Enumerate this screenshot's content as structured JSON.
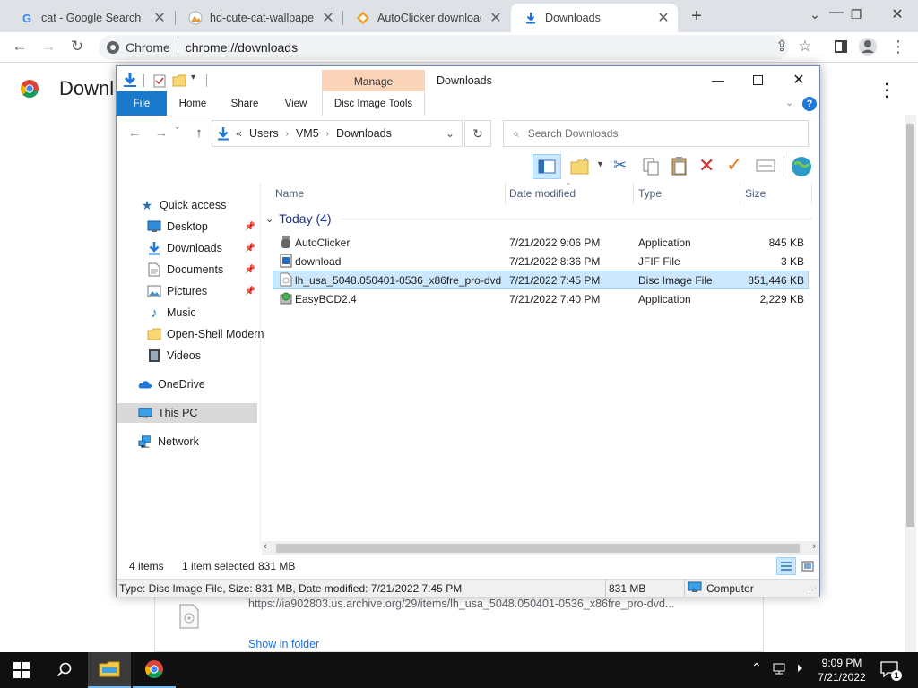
{
  "browser": {
    "tabs": [
      {
        "title": "cat - Google Search",
        "favicon": "google-g-icon"
      },
      {
        "title": "hd-cute-cat-wallpaper",
        "favicon": "image-icon"
      },
      {
        "title": "AutoClicker download",
        "favicon": "softonic-icon"
      },
      {
        "title": "Downloads",
        "favicon": "download-icon"
      }
    ],
    "new_tab": "+",
    "omnibox_label": "Chrome",
    "omnibox_url": "chrome://downloads",
    "page_title": "Downl"
  },
  "download_item": {
    "url": "https://ia902803.us.archive.org/29/items/lh_usa_5048.050401-0536_x86fre_pro-dvd...",
    "show_in_folder": "Show in folder"
  },
  "explorer": {
    "title": "Downloads",
    "manage": "Manage",
    "ribbon_tabs": [
      "File",
      "Home",
      "Share",
      "View",
      "Disc Image Tools"
    ],
    "breadcrumb": [
      "Users",
      "VM5",
      "Downloads"
    ],
    "breadcrumb_prefix": "«",
    "search_placeholder": "Search Downloads",
    "nav": [
      {
        "label": "Quick access",
        "icon": "star-icon"
      },
      {
        "label": "Desktop",
        "icon": "desktop-icon",
        "pinned": true
      },
      {
        "label": "Downloads",
        "icon": "download-icon",
        "pinned": true
      },
      {
        "label": "Documents",
        "icon": "document-icon",
        "pinned": true
      },
      {
        "label": "Pictures",
        "icon": "pictures-icon",
        "pinned": true
      },
      {
        "label": "Music",
        "icon": "music-icon"
      },
      {
        "label": "Open-Shell Modern",
        "icon": "folder-icon"
      },
      {
        "label": "Videos",
        "icon": "video-icon"
      },
      {
        "label": "OneDrive",
        "icon": "cloud-icon"
      },
      {
        "label": "This PC",
        "icon": "computer-icon",
        "selected": true
      },
      {
        "label": "Network",
        "icon": "network-icon"
      }
    ],
    "columns": [
      "Name",
      "Date modified",
      "Type",
      "Size"
    ],
    "group": "Today (4)",
    "files": [
      {
        "name": "AutoClicker",
        "date": "7/21/2022 9:06 PM",
        "type": "Application",
        "size": "845 KB",
        "icon": "app-icon"
      },
      {
        "name": "download",
        "date": "7/21/2022 8:36 PM",
        "type": "JFIF File",
        "size": "3 KB",
        "icon": "image-file-icon"
      },
      {
        "name": "lh_usa_5048.050401-0536_x86fre_pro-dvd",
        "date": "7/21/2022 7:45 PM",
        "type": "Disc Image File",
        "size": "851,446 KB",
        "icon": "disc-image-icon",
        "selected": true
      },
      {
        "name": "EasyBCD2.4",
        "date": "7/21/2022 7:40 PM",
        "type": "Application",
        "size": "2,229 KB",
        "icon": "installer-icon"
      }
    ],
    "status": {
      "items": "4 items",
      "selected": "1 item selected",
      "size": "831 MB"
    },
    "details_bar": {
      "text": "Type: Disc Image File, Size: 831 MB, Date modified: 7/21/2022 7:45 PM",
      "size": "831 MB",
      "location": "Computer"
    }
  },
  "taskbar": {
    "time": "9:09 PM",
    "date": "7/21/2022",
    "notification_count": "1"
  }
}
